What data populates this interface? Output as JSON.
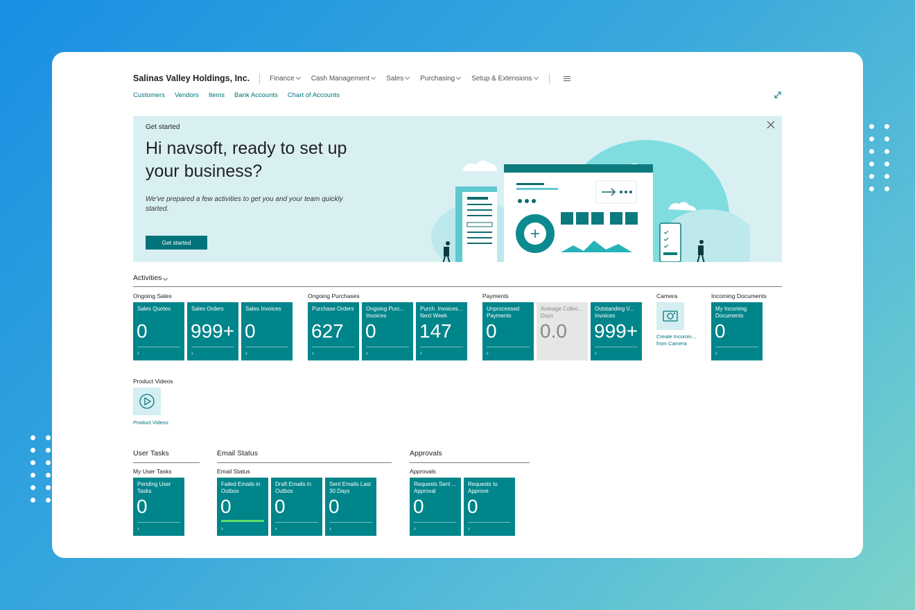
{
  "company": "Salinas Valley Holdings, Inc.",
  "menus": [
    "Finance",
    "Cash Management",
    "Sales",
    "Purchasing",
    "Setup & Extensions"
  ],
  "quicklinks": [
    "Customers",
    "Vendors",
    "Items",
    "Bank Accounts",
    "Chart of Accounts"
  ],
  "banner": {
    "tag": "Get started",
    "heading": "Hi navsoft, ready to set up your business?",
    "text": "We've prepared a few activities to get you and your team quickly started.",
    "button": "Get started"
  },
  "activities": {
    "title": "Activities",
    "ongoing_sales": {
      "title": "Ongoing Sales",
      "tiles": [
        {
          "label": "Sales Quotes",
          "value": "0"
        },
        {
          "label": "Sales Orders",
          "value": "999+"
        },
        {
          "label": "Sales Invoices",
          "value": "0"
        }
      ]
    },
    "ongoing_purchases": {
      "title": "Ongoing Purchases",
      "tiles": [
        {
          "label": "Purchase Orders",
          "value": "627"
        },
        {
          "label": "Ongoing Purc... Invoices",
          "value": "0"
        },
        {
          "label": "Purch. Invoices... Next Week",
          "value": "147"
        }
      ]
    },
    "payments": {
      "title": "Payments",
      "tiles": [
        {
          "label": "Unprocessed Payments",
          "value": "0"
        },
        {
          "label": "Average Collec... Days",
          "value": "0.0"
        },
        {
          "label": "Outstanding V... Invoices",
          "value": "999+"
        }
      ]
    },
    "camera": {
      "title": "Camera",
      "caption": "Create Incomin... from Camera"
    },
    "incoming_documents": {
      "title": "Incoming Documents",
      "tiles": [
        {
          "label": "My Incoming Documents",
          "value": "0"
        }
      ]
    },
    "product_videos": {
      "title": "Product Videos",
      "caption": "Product Videos"
    }
  },
  "user_tasks": {
    "section": "User Tasks",
    "group": "My User Tasks",
    "tiles": [
      {
        "label": "Pending User Tasks",
        "value": "0"
      }
    ]
  },
  "email_status": {
    "section": "Email Status",
    "group": "Email Status",
    "tiles": [
      {
        "label": "Failed Emails in Outbox",
        "value": "0"
      },
      {
        "label": "Draft Emails in Outbox",
        "value": "0"
      },
      {
        "label": "Sent Emails Last 30 Days",
        "value": "0"
      }
    ]
  },
  "approvals": {
    "section": "Approvals",
    "group": "Approvals",
    "tiles": [
      {
        "label": "Requests Sent ... Approval",
        "value": "0"
      },
      {
        "label": "Requests to Approve",
        "value": "0"
      }
    ]
  },
  "colors": {
    "accent": "#00858b",
    "link": "#00747a",
    "banner_bg": "#d9f0f3"
  },
  "icons": [
    "expand-icon",
    "close-icon",
    "hamburger-icon",
    "camera-icon",
    "play-icon"
  ]
}
